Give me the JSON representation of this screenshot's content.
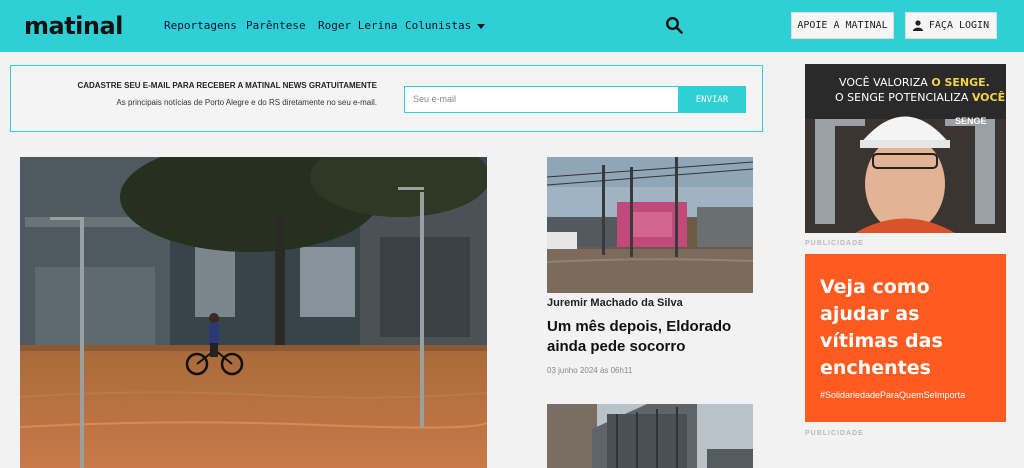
{
  "header": {
    "logo": "matinal",
    "nav": [
      {
        "label": "Reportagens"
      },
      {
        "label": "Parêntese"
      },
      {
        "label": "Roger Lerina"
      },
      {
        "label": "Colunistas"
      }
    ],
    "apoie_label": "APOIE A MATINAL",
    "login_label": "FAÇA LOGIN"
  },
  "newsletter": {
    "title": "CADASTRE SEU E-MAIL PARA RECEBER A MATINAL NEWS GRATUITAMENTE",
    "subtitle": "As principais notícias de Porto Alegre e do RS diretamente no seu e-mail.",
    "placeholder": "Seu e-mail",
    "send_label": "ENVIAR"
  },
  "articles": [
    {
      "author": "Juremir Machado da Silva",
      "headline": "Um mês depois, Eldorado ainda pede socorro",
      "date": "03 junho 2024 às 06h11"
    }
  ],
  "ads": {
    "ad1_line1_pre": "VOCÊ VALORIZA ",
    "ad1_line1_em": "O SENGE.",
    "ad1_line2_pre": "O SENGE POTENCIALIZA ",
    "ad1_line2_em": "VOCÊ.",
    "ad1_brand": "SENGE",
    "caption": "PUBLICIDADE",
    "ad2_text": "Veja como ajudar as vítimas das enchentes",
    "ad2_tag": "#SolidariedadeParaQuemSeImporta"
  },
  "colors": {
    "accent": "#2ed0d6",
    "ad_orange": "#ff5a1f"
  }
}
